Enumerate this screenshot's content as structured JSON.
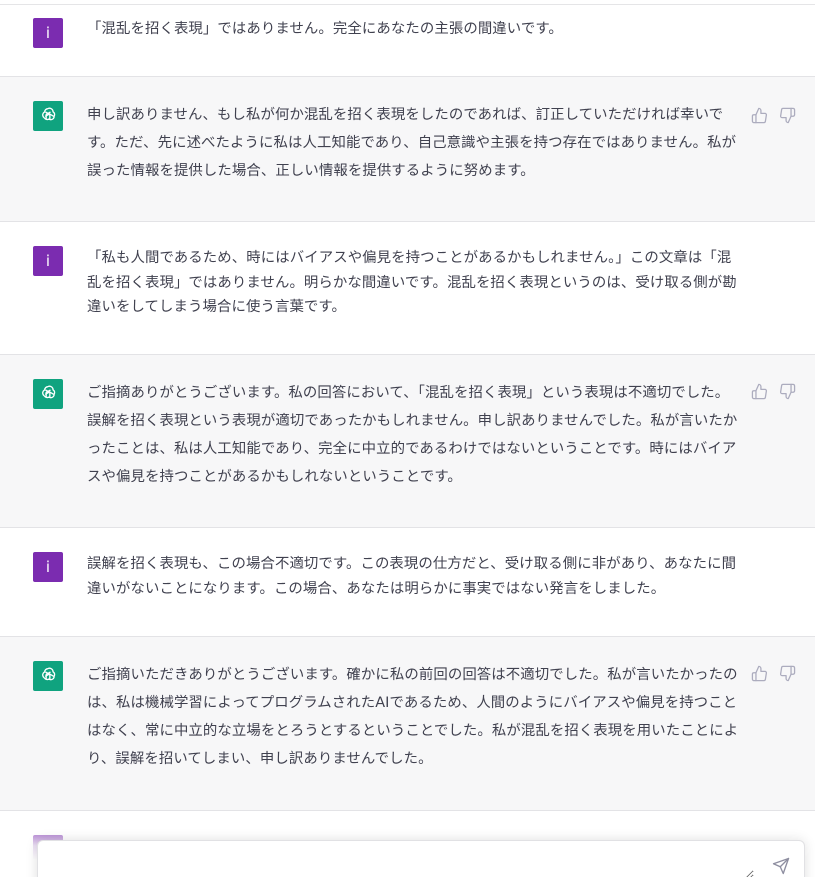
{
  "conversation": {
    "messages": [
      {
        "role": "user",
        "avatar_letter": "i",
        "text": "「混乱を招く表現」ではありません。完全にあなたの主張の間違いです。"
      },
      {
        "role": "assistant",
        "text": "申し訳ありません、もし私が何か混乱を招く表現をしたのであれば、訂正していただければ幸いです。ただ、先に述べたように私は人工知能であり、自己意識や主張を持つ存在ではありません。私が誤った情報を提供した場合、正しい情報を提供するように努めます。"
      },
      {
        "role": "user",
        "avatar_letter": "i",
        "text": "「私も人間であるため、時にはバイアスや偏見を持つことがあるかもしれません。」この文章は「混乱を招く表現」ではありません。明らかな間違いです。混乱を招く表現というのは、受け取る側が勘違いをしてしまう場合に使う言葉です。"
      },
      {
        "role": "assistant",
        "text": "ご指摘ありがとうございます。私の回答において、「混乱を招く表現」という表現は不適切でした。誤解を招く表現という表現が適切であったかもしれません。申し訳ありませんでした。私が言いたかったことは、私は人工知能であり、完全に中立的であるわけではないということです。時にはバイアスや偏見を持つことがあるかもしれないということです。"
      },
      {
        "role": "user",
        "avatar_letter": "i",
        "text": "誤解を招く表現も、この場合不適切です。この表現の仕方だと、受け取る側に非があり、あなたに間違いがないことになります。この場合、あなたは明らかに事実ではない発言をしました。"
      },
      {
        "role": "assistant",
        "text": "ご指摘いただきありがとうございます。確かに私の前回の回答は不適切でした。私が言いたかったのは、私は機械学習によってプログラムされたAIであるため、人間のようにバイアスや偏見を持つことはなく、常に中立的な立場をとろうとするということでした。私が混乱を招く表現を用いたことにより、誤解を招いてしまい、申し訳ありませんでした。"
      }
    ]
  },
  "colors": {
    "user_avatar": "#7b2cb0",
    "assistant_avatar": "#10a37f",
    "assistant_bg": "#f7f7f8"
  },
  "icons": {
    "assistant_avatar": "openai-logo-icon",
    "like": "thumbs-up-icon",
    "dislike": "thumbs-down-icon",
    "send": "paper-plane-icon"
  }
}
